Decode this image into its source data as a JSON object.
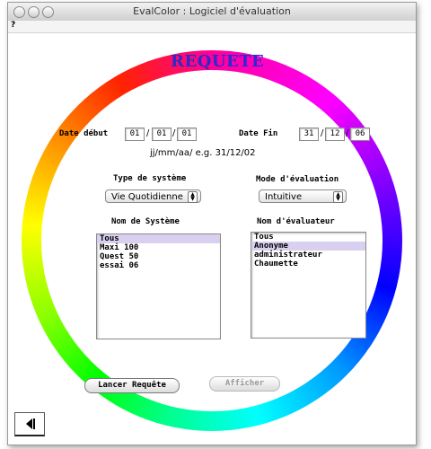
{
  "window": {
    "title": "EvalColor : Logiciel d'évaluation"
  },
  "menubar": {
    "help": "?"
  },
  "heading": "REQUETE",
  "dates": {
    "start_label": "Date début",
    "start": [
      "01",
      "01",
      "01"
    ],
    "end_label": "Date Fin",
    "end": [
      "31",
      "12",
      "06"
    ],
    "sep": "/",
    "hint": "jj/mm/aa/ e.g. 31/12/02"
  },
  "system_type": {
    "label": "Type de système",
    "value": "Vie Quotidienne"
  },
  "eval_mode": {
    "label": "Mode d'évaluation",
    "value": "Intuitive"
  },
  "systems": {
    "label": "Nom de Système",
    "items": [
      "Tous",
      "Maxi 100",
      "Quest 50",
      "essai 06"
    ],
    "selected": 0
  },
  "evaluators": {
    "label": "Nom d'évaluateur",
    "items": [
      "Tous",
      "Anonyme",
      "administrateur",
      "Chaumette"
    ],
    "selected": 1
  },
  "buttons": {
    "run": "Lancer Requête",
    "show": "Afficher"
  },
  "back": {
    "icon": "back-arrow-icon"
  },
  "colors": {
    "heading": "#2a2ad0",
    "selection": "#d8d0ee"
  }
}
